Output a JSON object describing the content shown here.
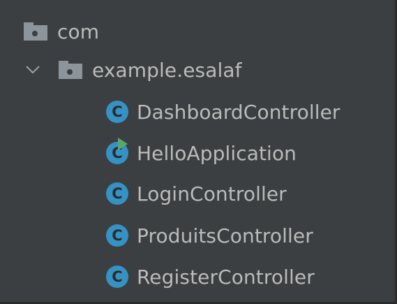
{
  "tree": {
    "package_com": {
      "label": "com",
      "icon": "package-folder-icon"
    },
    "package_example": {
      "label": "example.esalaf",
      "icon": "package-folder-icon",
      "expanded": true
    },
    "class_icon_letter": "C",
    "classes": [
      {
        "label": "DashboardController",
        "icon": "class-icon",
        "runnable": false
      },
      {
        "label": "HelloApplication",
        "icon": "class-runnable-icon",
        "runnable": true
      },
      {
        "label": "LoginController",
        "icon": "class-icon",
        "runnable": false
      },
      {
        "label": "ProduitsController",
        "icon": "class-icon",
        "runnable": false
      },
      {
        "label": "RegisterController",
        "icon": "class-icon",
        "runnable": false
      }
    ]
  },
  "colors": {
    "background": "#3c3f41",
    "text": "#bbbbbb",
    "folder": "#8c959c",
    "class_badge": "#3592c4",
    "run_marker": "#59a869"
  }
}
